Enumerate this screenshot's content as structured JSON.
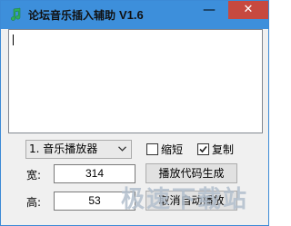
{
  "window": {
    "title": "论坛音乐插入辅助",
    "version": "V1.6",
    "min_glyph": "—",
    "max_glyph": "☐",
    "close_glyph": "✕"
  },
  "output_text": "",
  "player_select": {
    "selected": "1. 音乐播放器"
  },
  "checkboxes": {
    "shorten": {
      "label": "缩短",
      "checked": false
    },
    "copy": {
      "label": "复制",
      "checked": true
    }
  },
  "width_field": {
    "label": "宽:",
    "value": "314"
  },
  "height_field": {
    "label": "高:",
    "value": "53"
  },
  "buttons": {
    "generate": "播放代码生成",
    "cancel_autoplay": "取消自动播放"
  },
  "watermark": "极速下载站",
  "colors": {
    "titlebar": "#3d8fdb",
    "close": "#c7493f"
  }
}
